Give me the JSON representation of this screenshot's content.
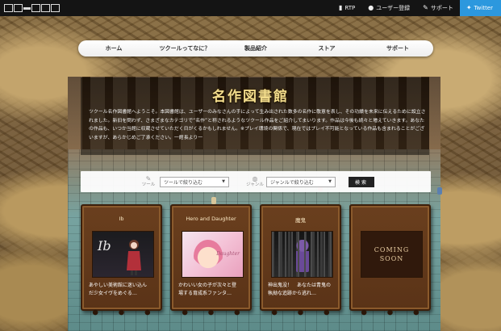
{
  "topbar": {
    "logo_alt": "",
    "links": [
      {
        "icon": "book-icon",
        "label": "RTP"
      },
      {
        "icon": "user-icon",
        "label": "ユーザー登録"
      },
      {
        "icon": "wrench-icon",
        "label": "サポート"
      },
      {
        "icon": "twitter-icon",
        "label": "Twitter"
      }
    ]
  },
  "nav": {
    "items": [
      "ホーム",
      "ツクールってなに？",
      "製品紹介",
      "ストア",
      "サポート"
    ]
  },
  "hero": {
    "title": "名作図書館",
    "intro": "ツクール名作図書館へようこそ。本図書館は、ユーザーのみなさんの手によって生み出された数多の名作に敬意を表し、その功績を未来に伝えるために設立されました。新旧を問わず、さまざまなカテゴリで“名作”と称されるようなツクール作品をご紹介してまいります。作品は今後も続々と増えていきます。あなたの作品も、いつか当館に収蔵させていただく日がくるかもしれません。※プレイ環境の関係で、現在ではプレイ不可能となっている作品も含まれることがございますが、あらかじめご了承ください。一館長より一"
  },
  "filter": {
    "tool_label": "ツール",
    "tool_select": "ツールで絞り込む",
    "genre_label": "ジャンル",
    "genre_select": "ジャンルで絞り込む",
    "search_button": "検索"
  },
  "cards": [
    {
      "title": "Ib",
      "desc_line1": "あやしい美術館に迷い込ん",
      "desc_line2": "だ少女イヴをめぐる…"
    },
    {
      "title": "Hero and Daughter",
      "desc_line1": "かわいい女の子が次々と登",
      "desc_line2": "場する育成系ファンタ…",
      "thumb_logo": "Daughter"
    },
    {
      "title": "魔鬼",
      "desc_line1": "神出鬼没！　あなたは青鬼の",
      "desc_line2": "執拗な追跡から逃れ…"
    },
    {
      "title": "",
      "soon_line1": "COMING",
      "soon_line2": "SOON"
    }
  ],
  "colors": {
    "topbar": "#141414",
    "twitter": "#2c98de",
    "title_gold": "#f2dc8c",
    "card_wood": "#6a3f1e"
  }
}
